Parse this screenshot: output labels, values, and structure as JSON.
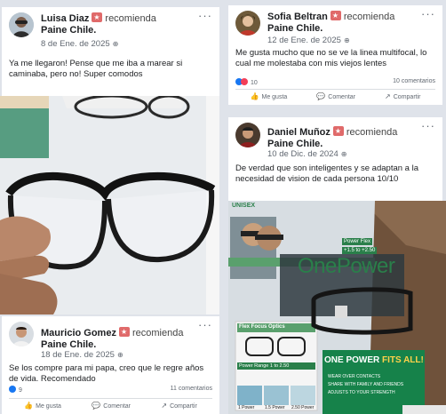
{
  "posts": [
    {
      "author": "Luisa Diaz",
      "recommends": "recomienda",
      "page": "Paine Chile.",
      "date": "8 de Ene. de 2025",
      "text": "Ya me llegaron! Pense que me iba a marear si caminaba, pero no! Super comodos"
    },
    {
      "author": "Sofia Beltran",
      "recommends": "recomienda",
      "page": "Paine Chile.",
      "date": "12 de Ene. de 2025",
      "text": "Me gusta mucho que no se ve la linea multifocal, lo cual me molestaba con mis viejos lentes",
      "reactions": "10",
      "comments": "10 comentarios",
      "like": "Me gusta",
      "comment": "Comentar",
      "share": "Compartir"
    },
    {
      "author": "Daniel Muñoz",
      "recommends": "recomienda",
      "page": "Paine Chile.",
      "date": "10 de Dic. de 2024",
      "text": "De verdad que son inteligentes y se adaptan a la necesidad de vision de cada persona 10/10"
    },
    {
      "author": "Mauricio Gomez",
      "recommends": "recomienda",
      "page": "Paine Chile.",
      "date": "18 de Ene. de 2025",
      "text": "Se los compre para mi papa, creo que le regre años de vida. Recomendado",
      "reactions": "9",
      "comments": "11 comentarios",
      "like": "Me gusta",
      "comment": "Comentar",
      "share": "Compartir"
    }
  ],
  "product_box": {
    "brand_top": "UNISEX",
    "brand": "OnePower",
    "power_flex": "Power Flex",
    "power_range": "+1.5 to +2.50",
    "flex_focus": "Flex Focus Optics",
    "power_range_small": "Power Range 1 to 2.50",
    "tagline_a": "ONE POWER",
    "tagline_b": "FITS ALL!",
    "features": [
      "WEAR OVER CONTACTS",
      "SHARE WITH FAMILY AND FRIENDS",
      "ADJUSTS TO YOUR STRENGTH"
    ],
    "power_labels": [
      "1 Power",
      "1.5 Power",
      "2.50 Power"
    ]
  },
  "icons": {
    "more": "more-horizontal-icon",
    "globe": "globe-icon",
    "like": "thumbs-up-icon",
    "comment": "comment-icon",
    "share": "share-icon"
  }
}
